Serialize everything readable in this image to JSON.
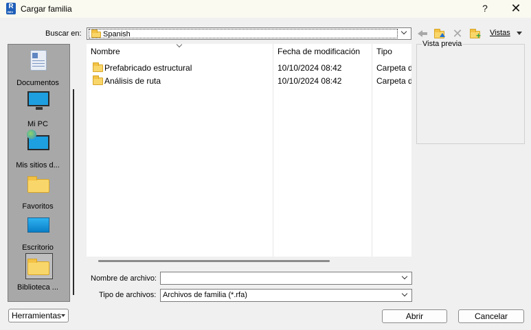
{
  "window": {
    "title": "Cargar familia",
    "help_label": "?",
    "close_label": "✕",
    "app_icon_letter": "R",
    "app_icon_sub": "REV"
  },
  "toolbar": {
    "lookin_label": "Buscar en:",
    "lookin_value": "Spanish",
    "views_label": "Vistas",
    "icons": [
      "back-arrow-icon",
      "up-folder-icon",
      "delete-icon",
      "new-folder-icon"
    ]
  },
  "places": [
    {
      "label": "Documentos",
      "icon": "documents-icon"
    },
    {
      "label": "Mi PC",
      "icon": "computer-icon"
    },
    {
      "label": "Mis sitios d...",
      "icon": "network-places-icon"
    },
    {
      "label": "Favoritos",
      "icon": "folder-icon"
    },
    {
      "label": "Escritorio",
      "icon": "desktop-icon"
    },
    {
      "label": "Biblioteca ...",
      "icon": "folder-icon",
      "selected": true
    }
  ],
  "filelist": {
    "columns": [
      "Nombre",
      "Fecha de modificación",
      "Tipo"
    ],
    "rows": [
      {
        "name": "Prefabricado estructural",
        "date": "10/10/2024 08:42",
        "type": "Carpeta de archivos"
      },
      {
        "name": "Análisis de ruta",
        "date": "10/10/2024 08:42",
        "type": "Carpeta de archivos"
      }
    ]
  },
  "preview": {
    "label": "Vista previa"
  },
  "form": {
    "filename_label": "Nombre de archivo:",
    "filename_value": "",
    "filetype_label": "Tipo de archivos:",
    "filetype_value": "Archivos de familia (*.rfa)"
  },
  "buttons": {
    "tools": "Herramientas",
    "open": "Abrir",
    "cancel": "Cancelar"
  },
  "colors": {
    "title_bg": "#fbfaf0",
    "places_bg": "#a8a8a8",
    "folder": "#f9d66a",
    "accent": "#1f5fb8"
  }
}
